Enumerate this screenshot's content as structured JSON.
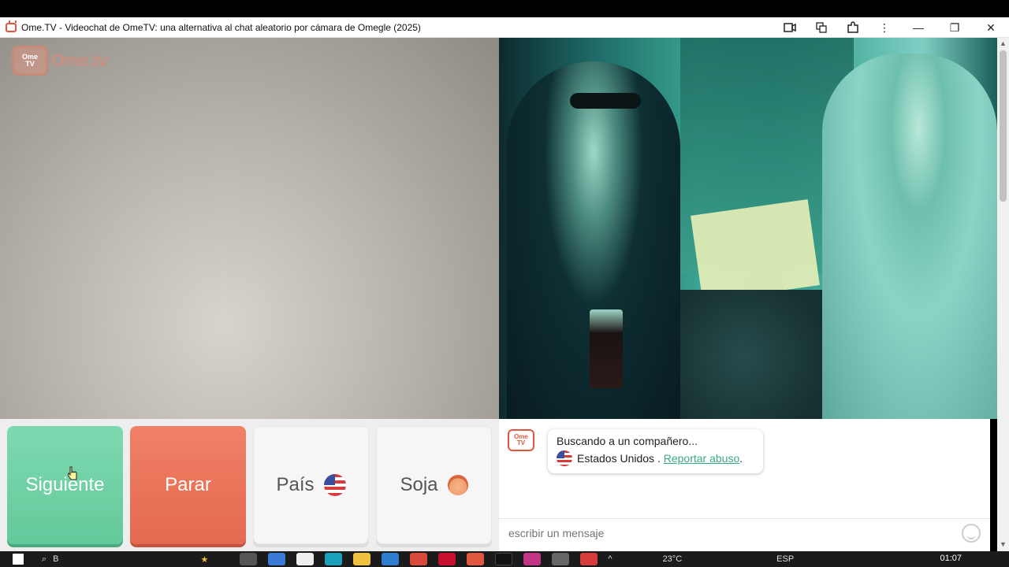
{
  "window": {
    "title": "Ome.TV - Videochat de OmeTV: una alternativa al chat aleatorio por cámara de Omegle (2025)"
  },
  "logo": {
    "icon_text_top": "Ome",
    "icon_text_bottom": "TV",
    "text": "Ome.tv"
  },
  "buttons": {
    "next": "Siguiente",
    "stop": "Parar",
    "country": "País",
    "gender": "Soja"
  },
  "chat": {
    "logo_top": "Ome",
    "logo_bottom": "TV",
    "searching": "Buscando a un compañero...",
    "country": "Estados Unidos",
    "separator": " . ",
    "report": "Reportar abuso",
    "report_suffix": ".",
    "placeholder": "escribir un mensaje"
  },
  "taskbar": {
    "time": "01:07",
    "search_hint": "B",
    "temperature": "23°C",
    "lang": "ESP"
  },
  "colors": {
    "next": "#6dd1a4",
    "stop": "#e8735a",
    "link": "#3aa88a",
    "brand": "#e0573f"
  }
}
